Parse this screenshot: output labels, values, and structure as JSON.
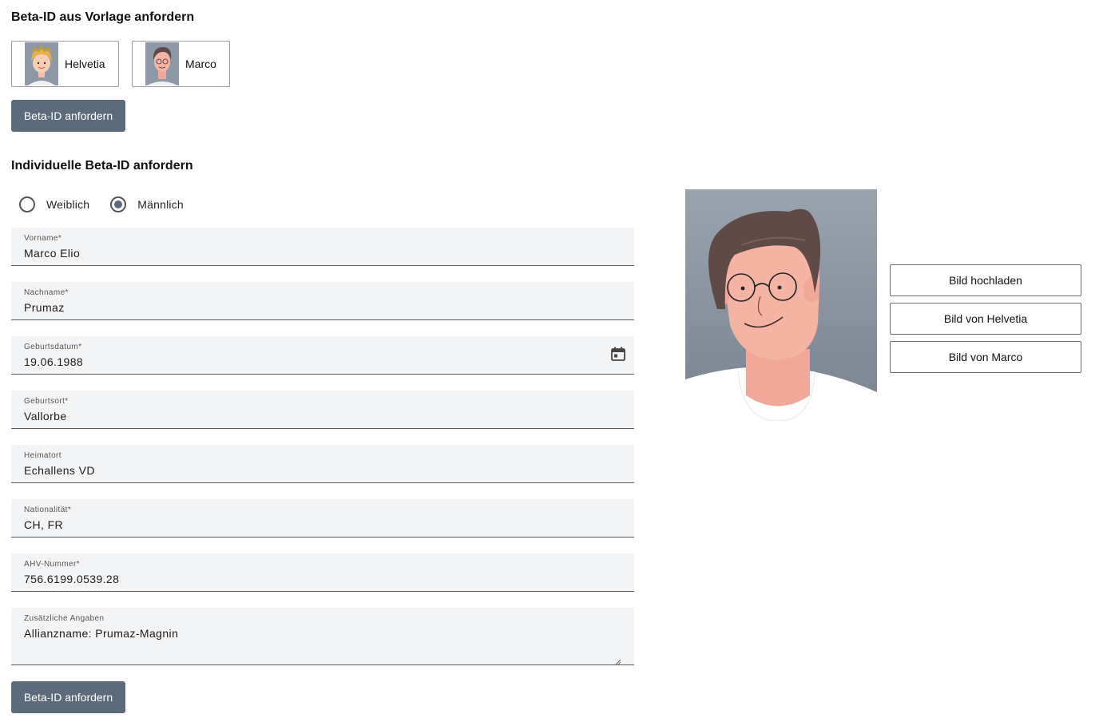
{
  "template_section": {
    "title": "Beta-ID aus Vorlage anfordern",
    "templates": [
      {
        "name": "Helvetia",
        "icon": "helvetia-avatar-icon"
      },
      {
        "name": "Marco",
        "icon": "marco-avatar-icon"
      }
    ],
    "request_button": "Beta-ID anfordern"
  },
  "individual_section": {
    "title": "Individuelle Beta-ID anfordern",
    "gender": {
      "options": [
        "Weiblich",
        "Männlich"
      ],
      "selected": "Männlich"
    },
    "fields": {
      "vorname": {
        "label": "Vorname*",
        "value": "Marco Elio"
      },
      "nachname": {
        "label": "Nachname*",
        "value": "Prumaz"
      },
      "geburtsdatum": {
        "label": "Geburtsdatum*",
        "value": "19.06.1988",
        "icon": "calendar-icon"
      },
      "geburtsort": {
        "label": "Geburtsort*",
        "value": "Vallorbe"
      },
      "heimatort": {
        "label": "Heimatort",
        "value": "Echallens VD"
      },
      "nationalitaet": {
        "label": "Nationalität*",
        "value": "CH, FR"
      },
      "ahv": {
        "label": "AHV-Nummer*",
        "value": "756.6199.0539.28"
      },
      "zusatz": {
        "label": "Zusätzliche Angaben",
        "value": "Allianzname: Prumaz-Magnin"
      }
    },
    "submit_button": "Beta-ID anfordern"
  },
  "photo": {
    "icon": "portrait-image",
    "buttons": {
      "upload": "Bild hochladen",
      "helvetia": "Bild von Helvetia",
      "marco": "Bild von Marco"
    }
  },
  "colors": {
    "primary_button": "#5b6b7b",
    "field_background": "#f3f4f6",
    "radio_selected": "#5b6b7b"
  }
}
